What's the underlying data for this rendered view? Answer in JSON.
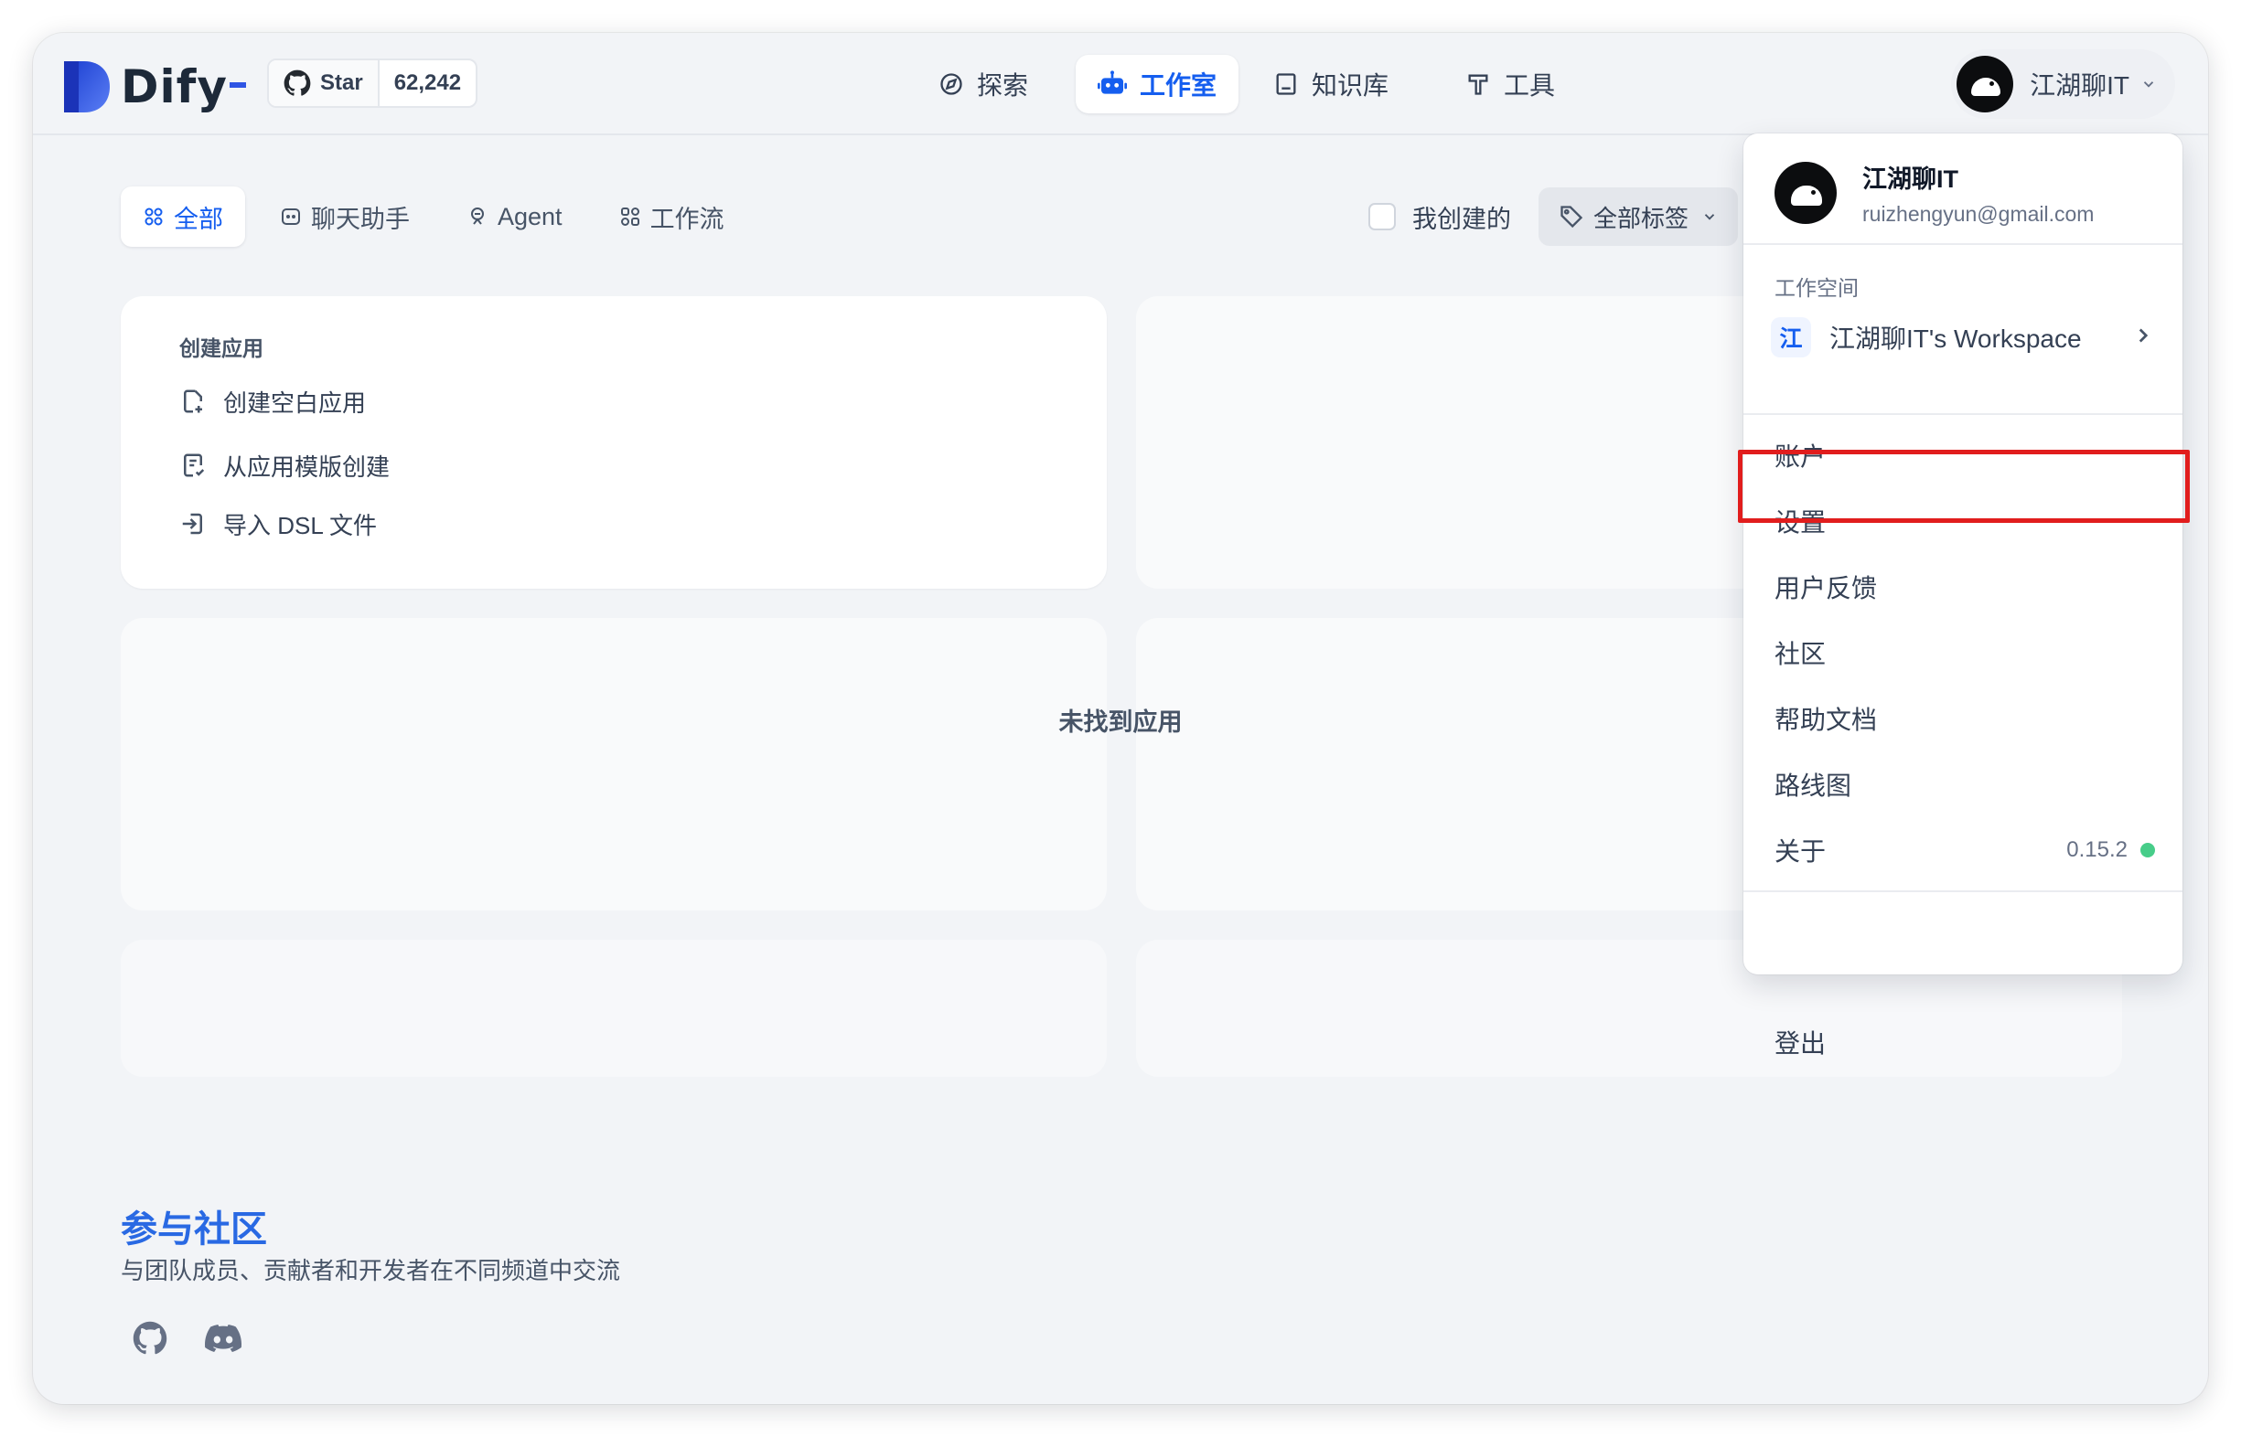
{
  "brand": {
    "name": "Dify",
    "accent": "#155eef"
  },
  "github": {
    "star_label": "Star",
    "star_count": "62,242"
  },
  "nav": [
    {
      "label": "探索",
      "icon": "explore-icon",
      "active": false
    },
    {
      "label": "工作室",
      "icon": "robot-icon",
      "active": true
    },
    {
      "label": "知识库",
      "icon": "book-icon",
      "active": false
    },
    {
      "label": "工具",
      "icon": "hammer-icon",
      "active": false
    }
  ],
  "user": {
    "name": "江湖聊IT",
    "email": "ruizhengyun@gmail.com"
  },
  "tabs": [
    {
      "label": "全部",
      "icon": "grid-icon",
      "active": true
    },
    {
      "label": "聊天助手",
      "icon": "chat-icon",
      "active": false
    },
    {
      "label": "Agent",
      "icon": "agent-icon",
      "active": false
    },
    {
      "label": "工作流",
      "icon": "workflow-icon",
      "active": false
    }
  ],
  "filters": {
    "mine_label": "我创建的",
    "mine_checked": false,
    "tag_label": "全部标签"
  },
  "create_card": {
    "title": "创建应用",
    "items": [
      {
        "label": "创建空白应用",
        "icon": "new-file-icon"
      },
      {
        "label": "从应用模版创建",
        "icon": "template-icon"
      },
      {
        "label": "导入 DSL 文件",
        "icon": "import-icon"
      }
    ]
  },
  "empty_text": "未找到应用",
  "community": {
    "title": "参与社区",
    "subtitle": "与团队成员、贡献者和开发者在不同频道中交流"
  },
  "dropdown": {
    "workspace_label": "工作空间",
    "workspace_badge": "江",
    "workspace_name": "江湖聊IT's Workspace",
    "items": [
      {
        "label": "账户"
      },
      {
        "label": "设置",
        "highlighted": true
      },
      {
        "label": "用户反馈"
      },
      {
        "label": "社区"
      },
      {
        "label": "帮助文档"
      },
      {
        "label": "路线图"
      },
      {
        "label": "关于",
        "version": "0.15.2",
        "status_color": "#47cd89"
      }
    ],
    "logout_label": "登出"
  }
}
